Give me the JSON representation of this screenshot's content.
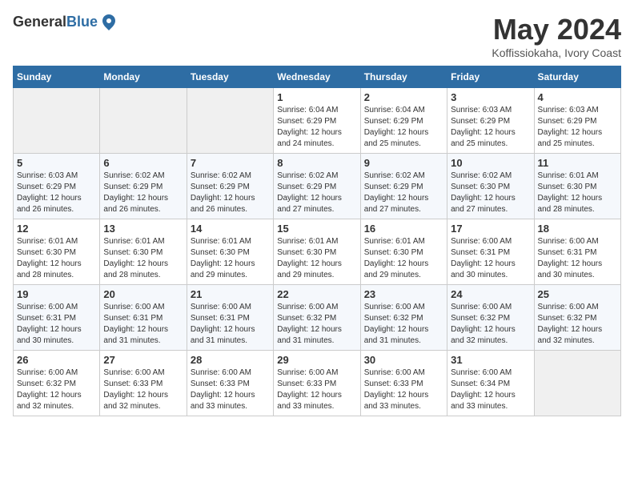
{
  "logo": {
    "general": "General",
    "blue": "Blue"
  },
  "header": {
    "month_year": "May 2024",
    "location": "Koffissiokaha, Ivory Coast"
  },
  "weekdays": [
    "Sunday",
    "Monday",
    "Tuesday",
    "Wednesday",
    "Thursday",
    "Friday",
    "Saturday"
  ],
  "weeks": [
    [
      {
        "day": null
      },
      {
        "day": null
      },
      {
        "day": null
      },
      {
        "day": "1",
        "sunrise": "6:04 AM",
        "sunset": "6:29 PM",
        "daylight": "12 hours and 24 minutes."
      },
      {
        "day": "2",
        "sunrise": "6:04 AM",
        "sunset": "6:29 PM",
        "daylight": "12 hours and 25 minutes."
      },
      {
        "day": "3",
        "sunrise": "6:03 AM",
        "sunset": "6:29 PM",
        "daylight": "12 hours and 25 minutes."
      },
      {
        "day": "4",
        "sunrise": "6:03 AM",
        "sunset": "6:29 PM",
        "daylight": "12 hours and 25 minutes."
      }
    ],
    [
      {
        "day": "5",
        "sunrise": "6:03 AM",
        "sunset": "6:29 PM",
        "daylight": "12 hours and 26 minutes."
      },
      {
        "day": "6",
        "sunrise": "6:02 AM",
        "sunset": "6:29 PM",
        "daylight": "12 hours and 26 minutes."
      },
      {
        "day": "7",
        "sunrise": "6:02 AM",
        "sunset": "6:29 PM",
        "daylight": "12 hours and 26 minutes."
      },
      {
        "day": "8",
        "sunrise": "6:02 AM",
        "sunset": "6:29 PM",
        "daylight": "12 hours and 27 minutes."
      },
      {
        "day": "9",
        "sunrise": "6:02 AM",
        "sunset": "6:29 PM",
        "daylight": "12 hours and 27 minutes."
      },
      {
        "day": "10",
        "sunrise": "6:02 AM",
        "sunset": "6:30 PM",
        "daylight": "12 hours and 27 minutes."
      },
      {
        "day": "11",
        "sunrise": "6:01 AM",
        "sunset": "6:30 PM",
        "daylight": "12 hours and 28 minutes."
      }
    ],
    [
      {
        "day": "12",
        "sunrise": "6:01 AM",
        "sunset": "6:30 PM",
        "daylight": "12 hours and 28 minutes."
      },
      {
        "day": "13",
        "sunrise": "6:01 AM",
        "sunset": "6:30 PM",
        "daylight": "12 hours and 28 minutes."
      },
      {
        "day": "14",
        "sunrise": "6:01 AM",
        "sunset": "6:30 PM",
        "daylight": "12 hours and 29 minutes."
      },
      {
        "day": "15",
        "sunrise": "6:01 AM",
        "sunset": "6:30 PM",
        "daylight": "12 hours and 29 minutes."
      },
      {
        "day": "16",
        "sunrise": "6:01 AM",
        "sunset": "6:30 PM",
        "daylight": "12 hours and 29 minutes."
      },
      {
        "day": "17",
        "sunrise": "6:00 AM",
        "sunset": "6:31 PM",
        "daylight": "12 hours and 30 minutes."
      },
      {
        "day": "18",
        "sunrise": "6:00 AM",
        "sunset": "6:31 PM",
        "daylight": "12 hours and 30 minutes."
      }
    ],
    [
      {
        "day": "19",
        "sunrise": "6:00 AM",
        "sunset": "6:31 PM",
        "daylight": "12 hours and 30 minutes."
      },
      {
        "day": "20",
        "sunrise": "6:00 AM",
        "sunset": "6:31 PM",
        "daylight": "12 hours and 31 minutes."
      },
      {
        "day": "21",
        "sunrise": "6:00 AM",
        "sunset": "6:31 PM",
        "daylight": "12 hours and 31 minutes."
      },
      {
        "day": "22",
        "sunrise": "6:00 AM",
        "sunset": "6:32 PM",
        "daylight": "12 hours and 31 minutes."
      },
      {
        "day": "23",
        "sunrise": "6:00 AM",
        "sunset": "6:32 PM",
        "daylight": "12 hours and 31 minutes."
      },
      {
        "day": "24",
        "sunrise": "6:00 AM",
        "sunset": "6:32 PM",
        "daylight": "12 hours and 32 minutes."
      },
      {
        "day": "25",
        "sunrise": "6:00 AM",
        "sunset": "6:32 PM",
        "daylight": "12 hours and 32 minutes."
      }
    ],
    [
      {
        "day": "26",
        "sunrise": "6:00 AM",
        "sunset": "6:32 PM",
        "daylight": "12 hours and 32 minutes."
      },
      {
        "day": "27",
        "sunrise": "6:00 AM",
        "sunset": "6:33 PM",
        "daylight": "12 hours and 32 minutes."
      },
      {
        "day": "28",
        "sunrise": "6:00 AM",
        "sunset": "6:33 PM",
        "daylight": "12 hours and 33 minutes."
      },
      {
        "day": "29",
        "sunrise": "6:00 AM",
        "sunset": "6:33 PM",
        "daylight": "12 hours and 33 minutes."
      },
      {
        "day": "30",
        "sunrise": "6:00 AM",
        "sunset": "6:33 PM",
        "daylight": "12 hours and 33 minutes."
      },
      {
        "day": "31",
        "sunrise": "6:00 AM",
        "sunset": "6:34 PM",
        "daylight": "12 hours and 33 minutes."
      },
      {
        "day": null
      }
    ]
  ],
  "labels": {
    "sunrise": "Sunrise:",
    "sunset": "Sunset:",
    "daylight": "Daylight:"
  }
}
